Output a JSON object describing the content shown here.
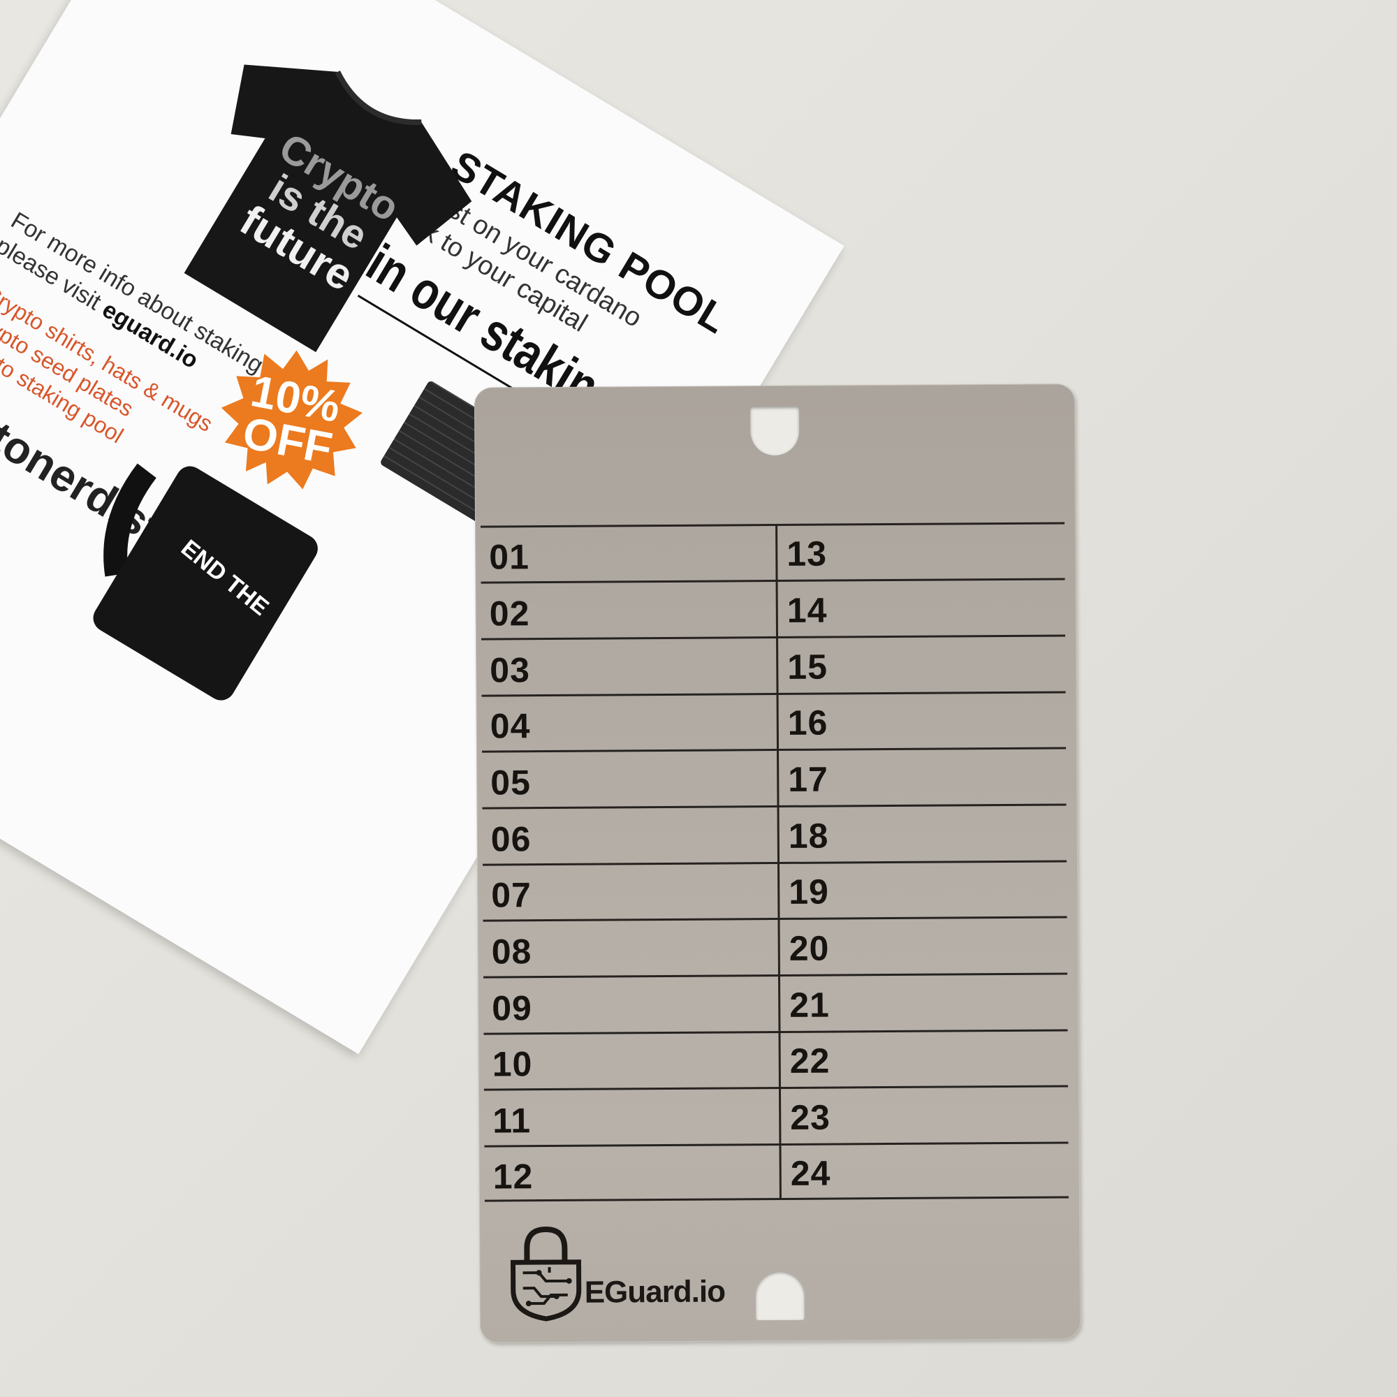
{
  "flyer": {
    "heading": "STAKING POOL",
    "line1": "rest on your cardano",
    "line2": "sk to your capital",
    "headline": "in our staking pool!",
    "tshirt_text": [
      "Crypto",
      "is the",
      "future"
    ],
    "badge_text": "10% OFF",
    "info_line1": "For more info about staking",
    "info_line2_prefix": "please visit ",
    "info_link": "eguard.io",
    "bullets": [
      "• Crypto shirts, hats & mugs",
      "• Crypto seed plates",
      "• Crypto staking pool"
    ],
    "store": "cryptonerd.store",
    "mug_text": "END THE"
  },
  "plate": {
    "left_numbers": [
      "01",
      "02",
      "03",
      "04",
      "05",
      "06",
      "07",
      "08",
      "09",
      "10",
      "11",
      "12"
    ],
    "right_numbers": [
      "13",
      "14",
      "15",
      "16",
      "17",
      "18",
      "19",
      "20",
      "21",
      "22",
      "23",
      "24"
    ],
    "brand": "EGuard.io"
  },
  "colors": {
    "background": "#e6e4df",
    "plate": "#b3ada5",
    "engraving": "#161310",
    "badge": "#ec7a1e",
    "bullet_text": "#d8562a"
  },
  "icons": [
    "padlock-circuit-icon",
    "tshirt-icon",
    "mug-icon"
  ]
}
